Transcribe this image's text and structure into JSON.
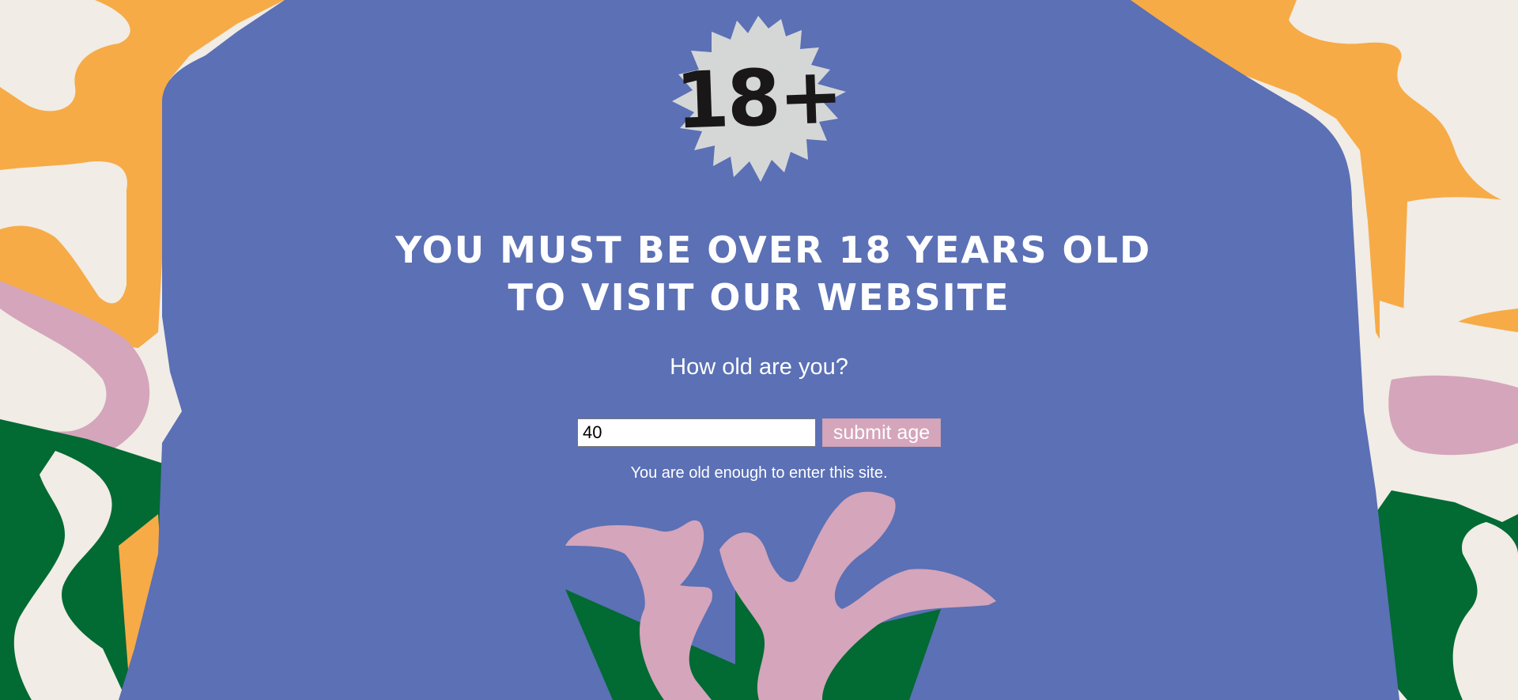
{
  "badge": {
    "text": "18+"
  },
  "headline": {
    "line1": "You must be over 18 years old",
    "line2": "to visit our website"
  },
  "question": "How old are you?",
  "age_form": {
    "input_value": "40",
    "submit_label": "submit age"
  },
  "result_message": "You are old enough to enter this site.",
  "colors": {
    "panel_blue": "#5b70b5",
    "background_cream": "#f1ece5",
    "accent_orange": "#f6ab47",
    "accent_pink": "#d4a5bb",
    "accent_green": "#026a33",
    "badge_gray": "#d5d7d7"
  }
}
